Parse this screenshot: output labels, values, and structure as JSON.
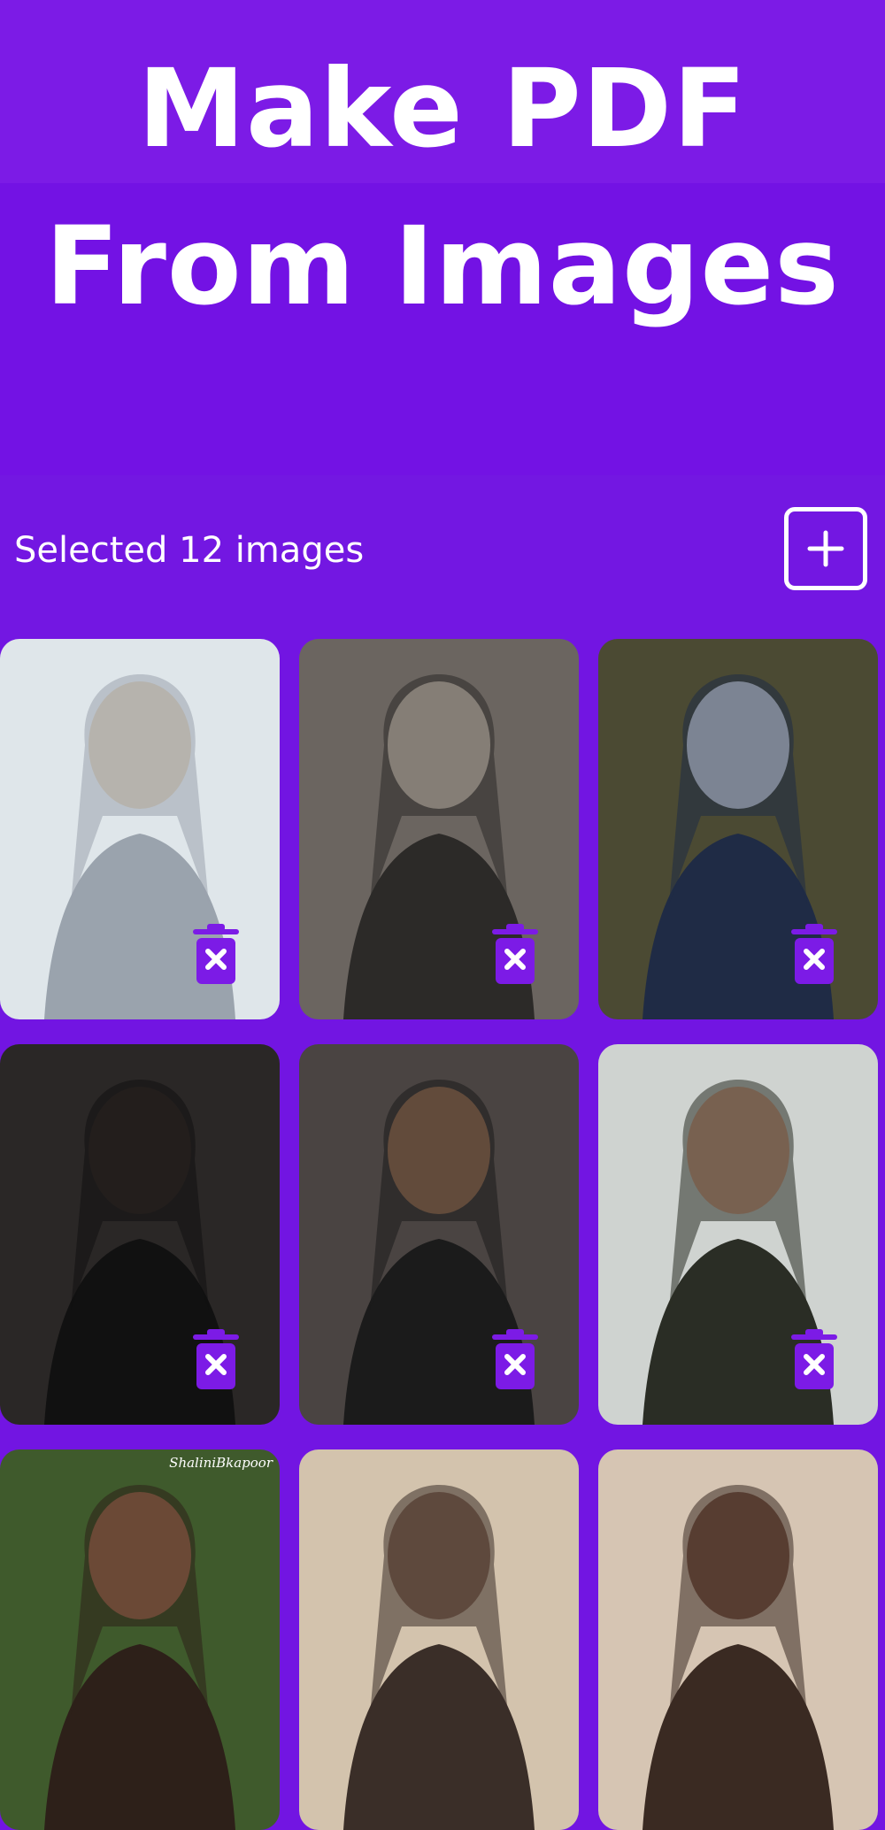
{
  "hero": {
    "line1": "Make PDF",
    "line2": "From Images"
  },
  "toolbar": {
    "selected_text": "Selected 12 images",
    "add_icon": "plus-square-icon"
  },
  "images": [
    {
      "palette": [
        "#dfe6ea",
        "#d8c8ad",
        "#9aa3ad"
      ],
      "delete_icon": "trash-x-icon"
    },
    {
      "palette": [
        "#6b6560",
        "#f1e5d6",
        "#2c2a28"
      ],
      "delete_icon": "trash-x-icon"
    },
    {
      "palette": [
        "#4b4a33",
        "#eef0f2",
        "#1f2b45"
      ],
      "delete_icon": "trash-x-icon"
    },
    {
      "palette": [
        "#2a2726",
        "#3b302c",
        "#111111"
      ],
      "delete_icon": "trash-x-icon"
    },
    {
      "palette": [
        "#4a4442",
        "#b98563",
        "#1b1b1b"
      ],
      "delete_icon": "trash-x-icon"
    },
    {
      "palette": [
        "#cfd3d0",
        "#d79f86",
        "#2a2d25"
      ],
      "delete_icon": "trash-x-icon"
    },
    {
      "palette": [
        "#3f5a2c",
        "#b77a5a",
        "#2d2019"
      ],
      "caption": "ShaliniBkapoor"
    },
    {
      "palette": [
        "#d3c3ad",
        "#8a6a58",
        "#3a2e28"
      ]
    },
    {
      "palette": [
        "#d6c5b3",
        "#7a5444",
        "#3a2a22"
      ]
    }
  ],
  "colors": {
    "background": "#7215e2",
    "hero_top": "#7c1be6",
    "accent": "#7c1be6",
    "text": "#ffffff"
  }
}
